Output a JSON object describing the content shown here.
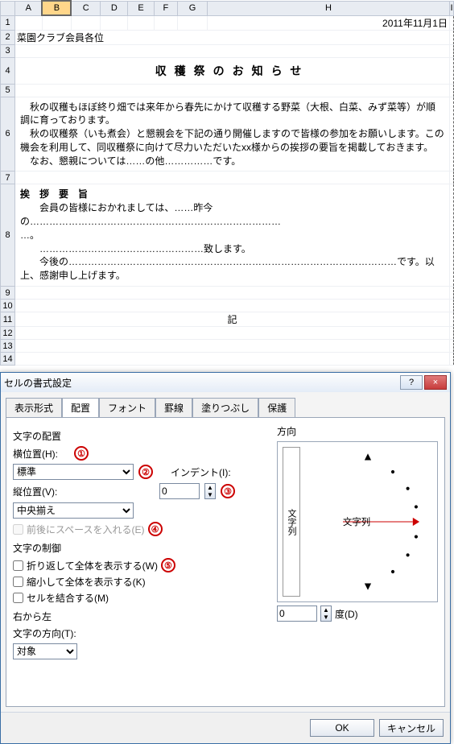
{
  "cols": [
    "A",
    "B",
    "C",
    "D",
    "E",
    "F",
    "G",
    "H",
    "I"
  ],
  "rows": [
    "1",
    "2",
    "3",
    "4",
    "5",
    "6",
    "7",
    "8",
    "9",
    "10",
    "11",
    "12",
    "13",
    "14"
  ],
  "doc": {
    "date": "2011年11月1日",
    "addressee": "菜園クラブ会員各位",
    "title": "収穫祭のお知らせ",
    "body_p1": "　秋の収穫もほぼ終り畑では来年から春先にかけて収穫する野菜（大根、白菜、みず菜等）が順調に育っております。",
    "body_p2": "　秋の収穫祭（いも煮会）と懇親会を下記の通り開催しますので皆様の参加をお願いします。この機会を利用して、同収穫祭に向けて尽力いただいたxx様からの挨拶の要旨を掲載しておきます。",
    "body_p3": "　なお、懇親については……の他……………です。",
    "greet_title": "挨　拶　要　旨",
    "greet_l1": "　　会員の皆様におかれましては、……昨今の……………………………………………………………………",
    "greet_l2": "…。",
    "greet_l3": "　　……………………………………………致します。",
    "greet_l4": "　　今後の…………………………………………………………………………………………です。以上、感謝申し上げます。",
    "ki": "記"
  },
  "dlg": {
    "title": "セルの書式設定",
    "help": "?",
    "close": "×",
    "tabs": {
      "t1": "表示形式",
      "t2": "配置",
      "t3": "フォント",
      "t4": "罫線",
      "t5": "塗りつぶし",
      "t6": "保護"
    },
    "align_group": "文字の配置",
    "horiz_lbl": "横位置(H):",
    "horiz_val": "標準",
    "vert_lbl": "縦位置(V):",
    "vert_val": "中央揃え",
    "justify_chk": "前後にスペースを入れる(E)",
    "indent_lbl": "インデント(I):",
    "indent_val": "0",
    "ctrl_group": "文字の制御",
    "wrap": "折り返して全体を表示する(W)",
    "shrink": "縮小して全体を表示する(K)",
    "merge": "セルを結合する(M)",
    "rtl_group": "右から左",
    "textdir_lbl": "文字の方向(T):",
    "textdir_val": "対象",
    "dir_lbl": "方向",
    "vtext": "文字列",
    "htext": "文字列",
    "deg_val": "0",
    "deg_lbl": "度(D)",
    "ok": "OK",
    "cancel": "キャンセル"
  },
  "annot": {
    "a1": "①",
    "a2": "②",
    "a3": "③",
    "a4": "④",
    "a5": "⑤"
  }
}
